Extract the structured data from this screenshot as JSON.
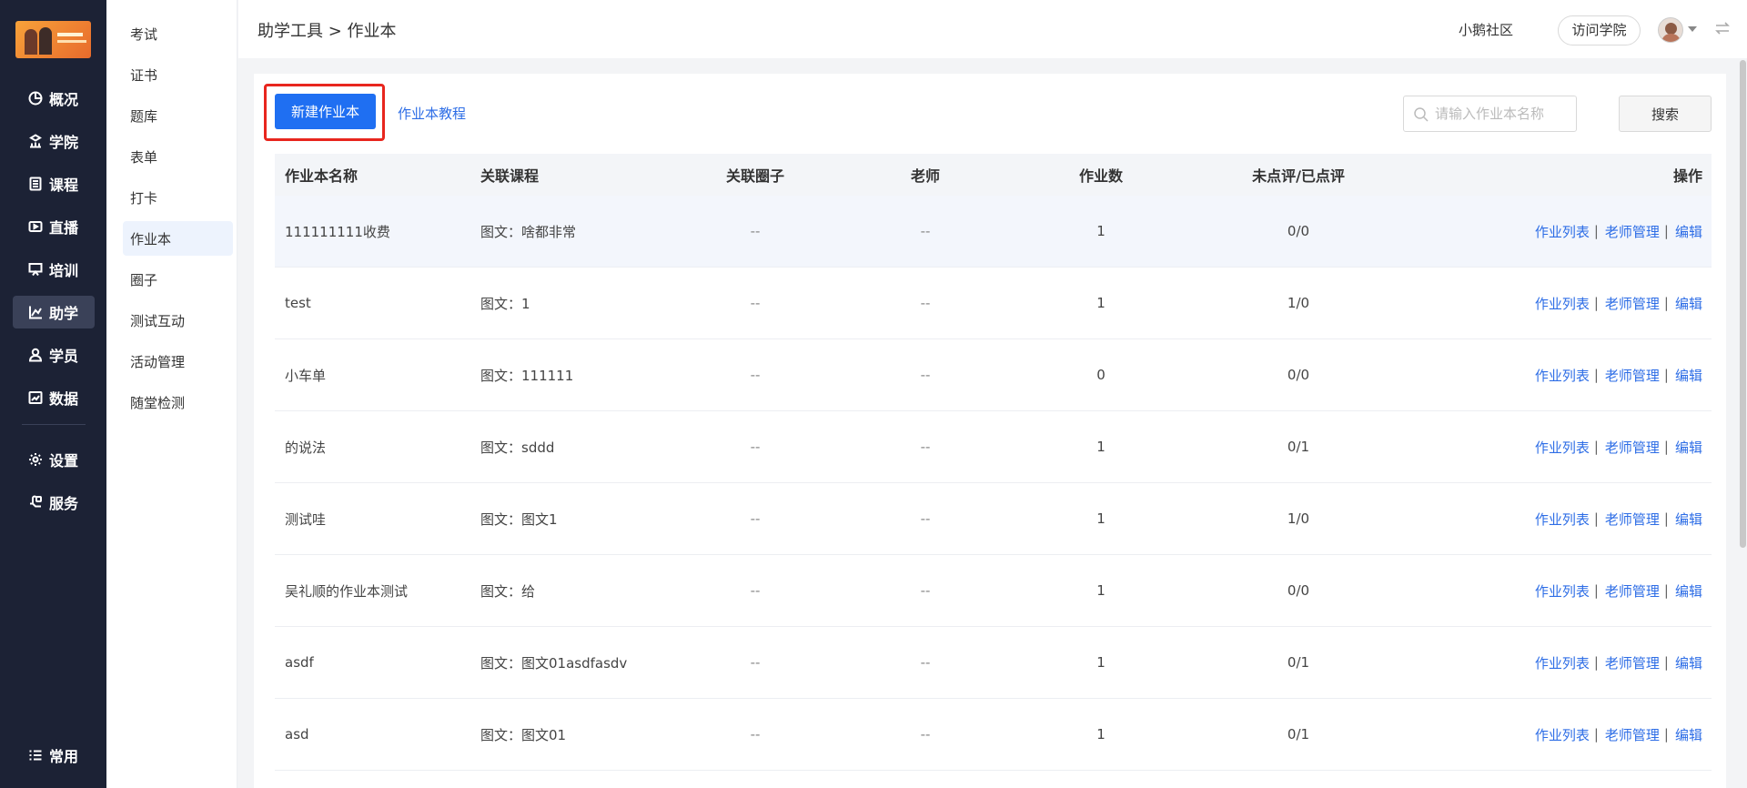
{
  "nav": {
    "items": [
      {
        "label": "概况",
        "icon": "pie-chart-icon"
      },
      {
        "label": "学院",
        "icon": "academy-icon"
      },
      {
        "label": "课程",
        "icon": "course-icon"
      },
      {
        "label": "直播",
        "icon": "live-icon"
      },
      {
        "label": "培训",
        "icon": "training-icon"
      },
      {
        "label": "助学",
        "icon": "assist-chart-icon",
        "active": true
      },
      {
        "label": "学员",
        "icon": "student-icon"
      },
      {
        "label": "数据",
        "icon": "data-icon"
      }
    ],
    "items2": [
      {
        "label": "设置",
        "icon": "gear-icon"
      },
      {
        "label": "服务",
        "icon": "service-icon"
      }
    ],
    "bottom": {
      "label": "常用",
      "icon": "list-icon"
    }
  },
  "subnav": {
    "items": [
      {
        "label": "考试"
      },
      {
        "label": "证书"
      },
      {
        "label": "题库"
      },
      {
        "label": "表单"
      },
      {
        "label": "打卡"
      },
      {
        "label": "作业本",
        "active": true
      },
      {
        "label": "圈子"
      },
      {
        "label": "测试互动"
      },
      {
        "label": "活动管理"
      },
      {
        "label": "随堂检测"
      }
    ]
  },
  "topbar": {
    "breadcrumb": "助学工具 > 作业本",
    "community": "小鹅社区",
    "visit_button": "访问学院"
  },
  "toolbar": {
    "new_button": "新建作业本",
    "tutorial_link": "作业本教程",
    "search_placeholder": "请输入作业本名称",
    "search_button": "搜索"
  },
  "table": {
    "headers": {
      "name": "作业本名称",
      "course": "关联课程",
      "circle": "关联圈子",
      "teacher": "老师",
      "count": "作业数",
      "review": "未点评/已点评",
      "ops": "操作"
    },
    "ops_labels": {
      "list": "作业列表",
      "teachers": "老师管理",
      "edit": "编辑",
      "sep": "|"
    },
    "rows": [
      {
        "name": "111111111收费",
        "course": "图文：啥都非常",
        "circle": "--",
        "teacher": "--",
        "count": "1",
        "review": "0/0"
      },
      {
        "name": "test",
        "course": "图文：1",
        "circle": "--",
        "teacher": "--",
        "count": "1",
        "review": "1/0"
      },
      {
        "name": "小车单",
        "course": "图文：111111",
        "circle": "--",
        "teacher": "--",
        "count": "0",
        "review": "0/0"
      },
      {
        "name": "的说法",
        "course": "图文：sddd",
        "circle": "--",
        "teacher": "--",
        "count": "1",
        "review": "0/1"
      },
      {
        "name": "测试哇",
        "course": "图文：图文1",
        "circle": "--",
        "teacher": "--",
        "count": "1",
        "review": "1/0"
      },
      {
        "name": "吴礼顺的作业本测试",
        "course": "图文：给",
        "circle": "--",
        "teacher": "--",
        "count": "1",
        "review": "0/0"
      },
      {
        "name": "asdf",
        "course": "图文：图文01asdfasdv",
        "circle": "--",
        "teacher": "--",
        "count": "1",
        "review": "0/1"
      },
      {
        "name": "asd",
        "course": "图文：图文01",
        "circle": "--",
        "teacher": "--",
        "count": "1",
        "review": "0/1"
      }
    ]
  },
  "colors": {
    "nav_bg": "#1c2235",
    "primary": "#1f6ff2",
    "link": "#2d6de6",
    "highlight_border": "#e8261e"
  }
}
